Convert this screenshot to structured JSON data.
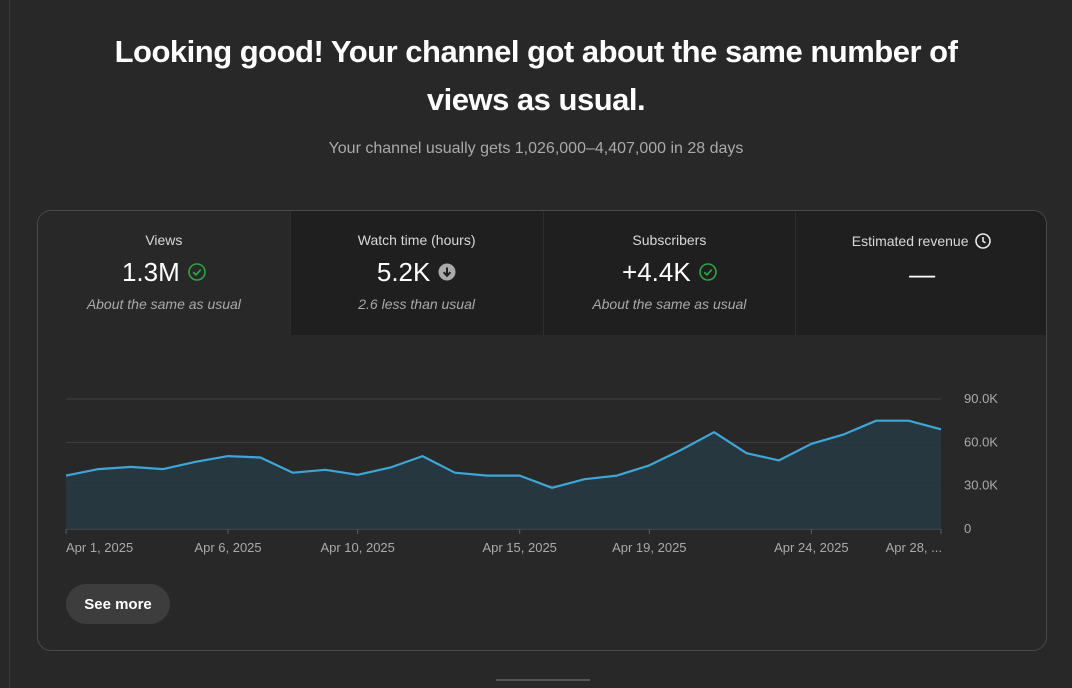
{
  "headline": "Looking good! Your channel got about the same number of views as usual.",
  "subline": "Your channel usually gets 1,026,000–4,407,000 in 28 days",
  "metrics": [
    {
      "label": "Views",
      "value": "1.3M",
      "icon": "check-circle-icon",
      "note": "About the same as usual"
    },
    {
      "label": "Watch time (hours)",
      "value": "5.2K",
      "icon": "arrow-down-circle-icon",
      "note": "2.6 less than usual"
    },
    {
      "label": "Subscribers",
      "value": "+4.4K",
      "icon": "check-circle-icon",
      "note": "About the same as usual"
    },
    {
      "label": "Estimated revenue",
      "label_icon": "clock-icon",
      "value": "—",
      "note": ""
    }
  ],
  "see_more_label": "See more",
  "colors": {
    "line": "#3ea6d6",
    "check": "#2ba640",
    "area": "#263a44",
    "grid": "#3f3f3f"
  },
  "chart_data": {
    "type": "area",
    "x_tick_labels": [
      "Apr 1, 2025",
      "Apr 6, 2025",
      "Apr 10, 2025",
      "Apr 15, 2025",
      "Apr 19, 2025",
      "Apr 24, 2025",
      "Apr 28, ..."
    ],
    "x_tick_indices": [
      0,
      5,
      9,
      14,
      18,
      23,
      27
    ],
    "y_tick_labels": [
      "0",
      "30.0K",
      "60.0K",
      "90.0K"
    ],
    "y_ticks": [
      0,
      30000,
      60000,
      90000
    ],
    "ylim": [
      0,
      90000
    ],
    "grid": true,
    "series": [
      {
        "values": [
          37000,
          41500,
          43000,
          41500,
          46500,
          50500,
          49500,
          39000,
          41000,
          37500,
          42500,
          50500,
          39000,
          37000,
          37000,
          28500,
          34500,
          37000,
          44000,
          55000,
          67000,
          52500,
          47500,
          59000,
          65500,
          75000,
          75000,
          69000
        ]
      }
    ]
  }
}
